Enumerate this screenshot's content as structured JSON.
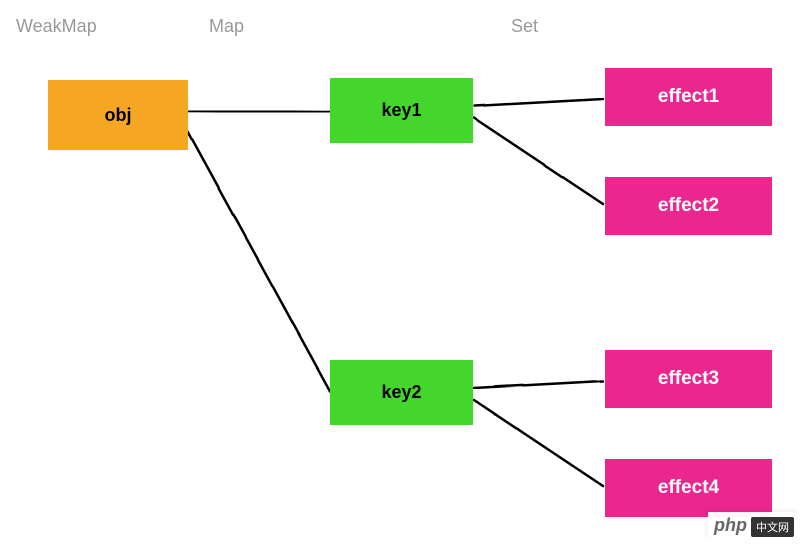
{
  "headers": {
    "weakmap": "WeakMap",
    "map": "Map",
    "set": "Set"
  },
  "nodes": {
    "obj": "obj",
    "key1": "key1",
    "key2": "key2",
    "effect1": "effect1",
    "effect2": "effect2",
    "effect3": "effect3",
    "effect4": "effect4"
  },
  "watermark": {
    "brand": "php",
    "suffix": "中文网"
  },
  "chart_data": {
    "type": "diagram",
    "title": "",
    "columns": [
      "WeakMap",
      "Map",
      "Set"
    ],
    "nodes": [
      {
        "id": "obj",
        "label": "obj",
        "column": "WeakMap",
        "color": "#f5a623"
      },
      {
        "id": "key1",
        "label": "key1",
        "column": "Map",
        "color": "#44d62c"
      },
      {
        "id": "key2",
        "label": "key2",
        "column": "Map",
        "color": "#44d62c"
      },
      {
        "id": "effect1",
        "label": "effect1",
        "column": "Set",
        "color": "#ec268f"
      },
      {
        "id": "effect2",
        "label": "effect2",
        "column": "Set",
        "color": "#ec268f"
      },
      {
        "id": "effect3",
        "label": "effect3",
        "column": "Set",
        "color": "#ec268f"
      },
      {
        "id": "effect4",
        "label": "effect4",
        "column": "Set",
        "color": "#ec268f"
      }
    ],
    "edges": [
      {
        "from": "obj",
        "to": "key1"
      },
      {
        "from": "obj",
        "to": "key2"
      },
      {
        "from": "key1",
        "to": "effect1"
      },
      {
        "from": "key1",
        "to": "effect2"
      },
      {
        "from": "key2",
        "to": "effect3"
      },
      {
        "from": "key2",
        "to": "effect4"
      }
    ]
  }
}
